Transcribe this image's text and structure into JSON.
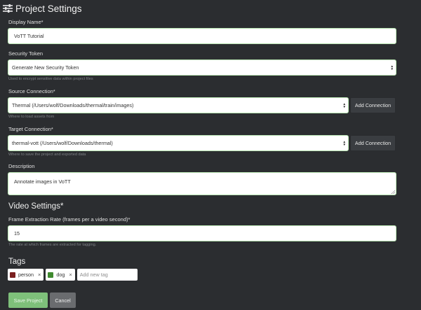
{
  "header": {
    "title": "Project Settings",
    "icon": "sliders-icon"
  },
  "display_name": {
    "label": "Display Name*",
    "value": "VoTT Tutorial"
  },
  "security_token": {
    "label": "Security Token",
    "value": "Generate New Security Token",
    "help": "Used to encrypt sensitive data within project files"
  },
  "source_connection": {
    "label": "Source Connection*",
    "value": "Thermal (/Users/wolf/Downloads/thermal/train/images)",
    "help": "Where to load assets from",
    "add_label": "Add Connection"
  },
  "target_connection": {
    "label": "Target Connection*",
    "value": "thermal-vott (/Users/wolf/Downloads/thermal)",
    "help": "Where to save the project and exported data",
    "add_label": "Add Connection"
  },
  "description": {
    "label": "Description",
    "value": "Annotate images in VoTT"
  },
  "video_settings": {
    "title": "Video Settings*",
    "frame_rate_label": "Frame Extraction Rate (frames per a video second)*",
    "frame_rate_value": "15",
    "help": "The rate at which frames are extracted for tagging."
  },
  "tags": {
    "title": "Tags",
    "items": [
      {
        "name": "person",
        "color": "#7a1f1f",
        "remove": "×"
      },
      {
        "name": "dog",
        "color": "#3f8a2f",
        "remove": "×"
      }
    ],
    "new_tag_placeholder": "Add new tag"
  },
  "actions": {
    "save_label": "Save Project",
    "cancel_label": "Cancel"
  }
}
